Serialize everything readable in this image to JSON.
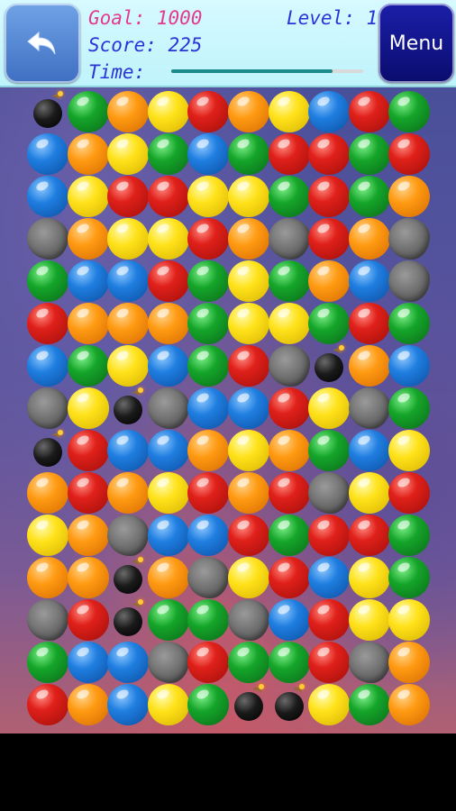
{
  "hud": {
    "goal_text": "Goal: 1000",
    "score_text": "Score: 225",
    "level_text": "Level: 1",
    "time_label": "Time:",
    "time_remaining_fraction": 0.84,
    "menu_label": "Menu",
    "back_icon": "undo-arrow-icon"
  },
  "colors": {
    "hud_background": "#c8f6fd",
    "goal_color": "#e23b8d",
    "text_color": "#2a34d6",
    "menu_button": "#12158a",
    "back_button": "#4f82d2",
    "time_bar": "#1b8a8a"
  },
  "board": {
    "legend": {
      "R": "red-ball",
      "O": "orange-ball",
      "Y": "yellow-ball",
      "G": "green-ball",
      "B": "blue-ball",
      "S": "stone-block",
      "K": "bomb"
    },
    "rows": [
      [
        "K",
        "G",
        "O",
        "Y",
        "R",
        "O",
        "Y",
        "B",
        "R",
        "G"
      ],
      [
        "B",
        "O",
        "Y",
        "G",
        "B",
        "G",
        "R",
        "R",
        "G",
        "R"
      ],
      [
        "B",
        "Y",
        "R",
        "R",
        "Y",
        "Y",
        "G",
        "R",
        "G",
        "O"
      ],
      [
        "S",
        "O",
        "Y",
        "Y",
        "R",
        "O",
        "S",
        "R",
        "O",
        "S"
      ],
      [
        "G",
        "B",
        "B",
        "R",
        "G",
        "Y",
        "G",
        "O",
        "B",
        "S"
      ],
      [
        "R",
        "O",
        "O",
        "O",
        "G",
        "Y",
        "Y",
        "G",
        "R",
        "G"
      ],
      [
        "B",
        "G",
        "Y",
        "B",
        "G",
        "R",
        "S",
        "K",
        "O",
        "B"
      ],
      [
        "S",
        "Y",
        "K",
        "S",
        "B",
        "B",
        "R",
        "Y",
        "S",
        "G"
      ],
      [
        "K",
        "R",
        "B",
        "B",
        "O",
        "Y",
        "O",
        "G",
        "B",
        "Y"
      ],
      [
        "O",
        "R",
        "O",
        "Y",
        "R",
        "O",
        "R",
        "S",
        "Y",
        "R"
      ],
      [
        "Y",
        "O",
        "S",
        "B",
        "B",
        "R",
        "G",
        "R",
        "R",
        "G"
      ],
      [
        "O",
        "O",
        "K",
        "O",
        "S",
        "Y",
        "R",
        "B",
        "Y",
        "G"
      ],
      [
        "S",
        "R",
        "K",
        "G",
        "G",
        "S",
        "B",
        "R",
        "Y",
        "Y"
      ],
      [
        "G",
        "B",
        "B",
        "S",
        "R",
        "G",
        "G",
        "R",
        "S",
        "O"
      ],
      [
        "R",
        "O",
        "B",
        "Y",
        "G",
        "K",
        "K",
        "Y",
        "G",
        "O"
      ]
    ]
  }
}
